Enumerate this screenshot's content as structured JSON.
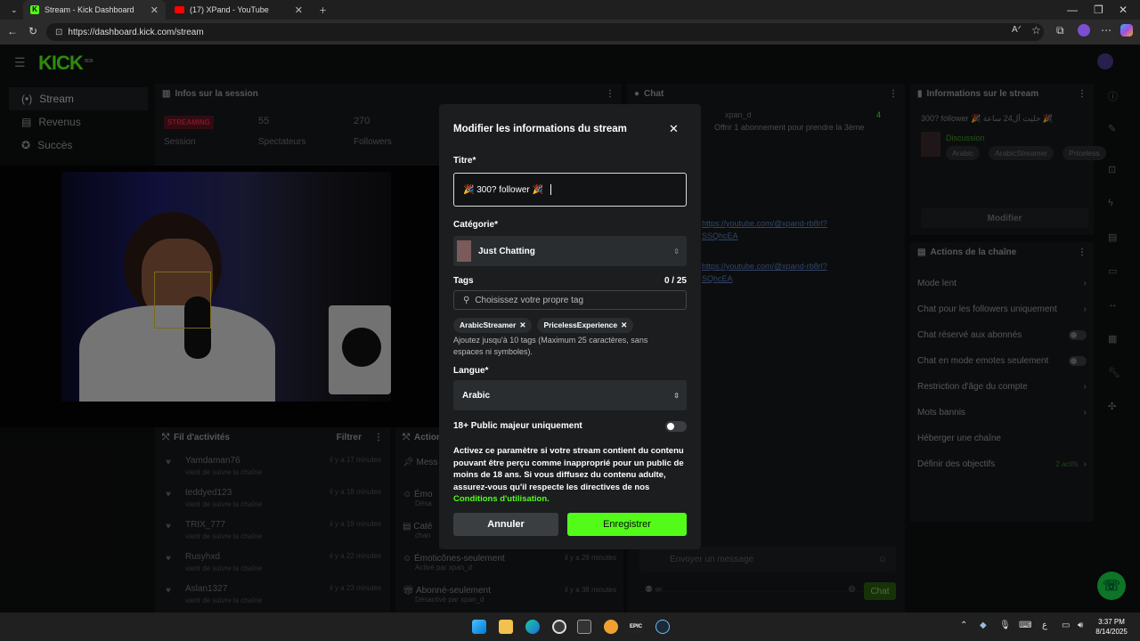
{
  "browser": {
    "tabs": [
      {
        "label": "Stream - Kick Dashboard"
      },
      {
        "label": "(17) XPand - YouTube"
      }
    ],
    "url": "https://dashboard.kick.com/stream"
  },
  "app": {
    "logo": "KICK",
    "logo_badge": "BETA",
    "nav": [
      {
        "label": "Stream",
        "icon": "stream-icon"
      },
      {
        "label": "Revenus",
        "icon": "revenue-icon"
      },
      {
        "label": "Succès",
        "icon": "achievements-icon"
      }
    ]
  },
  "session": {
    "title": "Infos sur la session",
    "status": "STREAMING",
    "status_label": "Session",
    "viewers": "55",
    "viewers_label": "Spectateurs",
    "followers": "270",
    "followers_label": "Followers"
  },
  "activity": {
    "title": "Fil d'activités",
    "filter": "Filtrer",
    "items": [
      {
        "name": "Yamdaman76",
        "sub": "vient de suivre la chaîne",
        "time": "il y a 17 minutes"
      },
      {
        "name": "teddyed123",
        "sub": "vient de suivre la chaîne",
        "time": "il y a 18 minutes"
      },
      {
        "name": "TRIX_777",
        "sub": "vient de suivre la chaîne",
        "time": "il y a 19 minutes"
      },
      {
        "name": "Rusyhxd",
        "sub": "vient de suivre la chaîne",
        "time": "il y a 22 minutes"
      },
      {
        "name": "Aslan1327",
        "sub": "vient de suivre la chaîne",
        "time": "il y a 23 minutes"
      }
    ]
  },
  "actions": {
    "title": "Action",
    "items": [
      {
        "name": "Mess",
        "sub": ""
      },
      {
        "name": "Émo",
        "sub": "Désa"
      },
      {
        "name": "Caté",
        "sub": "chan"
      },
      {
        "name": "Émoticônes-seulement",
        "sub": "Activé par xpan_d",
        "time": "il y a 29 minutes"
      },
      {
        "name": "Abonné-seulement",
        "sub": "Désactivé par xpan_d",
        "time": "il y a 38 minutes"
      }
    ]
  },
  "chat": {
    "title": "Chat",
    "top_user": "xpan_d",
    "top_count": "4",
    "top_msg": "Offrir 1 abonnement pour prendre la 3ème",
    "link1": "https://youtube.com/@xpand-rb8rl?",
    "link1b": "SSQhcEA",
    "link2": "https://youtube.com/@xpand-rb8rl?",
    "link2b": "SQhcEA",
    "placeholder": "Envoyer un message",
    "send": "Chat"
  },
  "stream_info": {
    "title": "Informations sur le stream",
    "stream_title": "300? follower 🎉 خليت آل24 ساعة 🎉",
    "category": "Discussion",
    "tags": [
      "Arabic",
      "ArabicStreamer",
      "Priceless"
    ],
    "edit": "Modifier"
  },
  "channel_actions": {
    "title": "Actions de la chaîne",
    "items": [
      {
        "label": "Mode lent",
        "kind": "arrow"
      },
      {
        "label": "Chat pour les followers uniquement",
        "kind": "arrow"
      },
      {
        "label": "Chat réservé aux abonnés",
        "kind": "toggle"
      },
      {
        "label": "Chat en mode emotes seulement",
        "kind": "toggle"
      },
      {
        "label": "Restriction d'âge du compte",
        "kind": "arrow"
      },
      {
        "label": "Mots bannis",
        "kind": "arrow"
      },
      {
        "label": "Héberger une chaîne",
        "kind": "none"
      },
      {
        "label": "Définir des objectifs",
        "kind": "arrow",
        "extra": "2 actifs"
      }
    ]
  },
  "modal": {
    "title": "Modifier les informations du stream",
    "title_label": "Titre*",
    "title_value": "🎉 300? follower 🎉",
    "category_label": "Catégorie*",
    "category_value": "Just Chatting",
    "tags_label": "Tags",
    "tags_count": "0 / 25",
    "tags_placeholder": "Choisissez votre propre tag",
    "tags": [
      "ArabicStreamer",
      "PricelessExperience"
    ],
    "tags_help": "Ajoutez jusqu'à 10 tags (Maximum 25 caractères, sans espaces ni symboles).",
    "language_label": "Langue*",
    "language_value": "Arabic",
    "mature_label": "18+ Public majeur uniquement",
    "mature_help": "Activez ce paramètre si votre stream contient du contenu pouvant être perçu comme inapproprié pour un public de moins de 18 ans. Si vous diffusez du contenu adulte, assurez-vous qu'il respecte les directives de nos",
    "mature_link": "Conditions d'utilisation.",
    "cancel": "Annuler",
    "save": "Enregistrer"
  },
  "taskbar": {
    "time": "3:37 PM",
    "date": "8/14/2025",
    "lang": "ع"
  },
  "colors": {
    "kick_green": "#53fc18",
    "streaming_red": "#e02a4a"
  }
}
